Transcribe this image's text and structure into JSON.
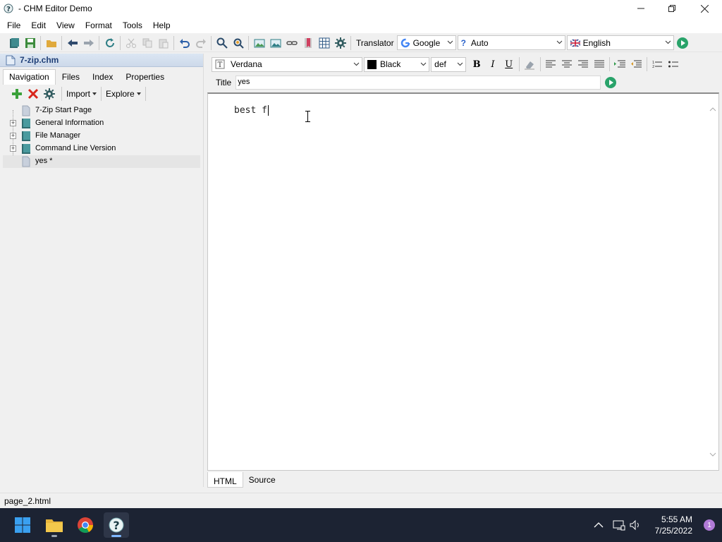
{
  "window": {
    "title": "- CHM Editor Demo"
  },
  "menu": [
    "File",
    "Edit",
    "View",
    "Format",
    "Tools",
    "Help"
  ],
  "toolbar": {
    "translator_label": "Translator",
    "engine": "Google",
    "source_lang": "Auto",
    "target_lang": "English"
  },
  "project": {
    "file_name": "7-zip.chm"
  },
  "left_tabs": [
    "Navigation",
    "Files",
    "Index",
    "Properties"
  ],
  "nav_tools": {
    "import_label": "Import",
    "explore_label": "Explore"
  },
  "tree": [
    {
      "label": "7-Zip Start Page",
      "type": "page",
      "expandable": false
    },
    {
      "label": "General Information",
      "type": "book",
      "expandable": true
    },
    {
      "label": "File Manager",
      "type": "book",
      "expandable": true
    },
    {
      "label": "Command Line Version",
      "type": "book",
      "expandable": true
    },
    {
      "label": "yes *",
      "type": "page",
      "expandable": false,
      "selected": true
    }
  ],
  "format": {
    "font": "Verdana",
    "color_name": "Black",
    "color_value": "#000000",
    "size": "def"
  },
  "topic": {
    "title_label": "Title",
    "title_value": "yes",
    "body_text": "best f"
  },
  "bottom_tabs": [
    "HTML",
    "Source"
  ],
  "status": {
    "file": "page_2.html"
  },
  "taskbar": {
    "time": "5:55 AM",
    "date": "7/25/2022",
    "notification_count": "1"
  }
}
